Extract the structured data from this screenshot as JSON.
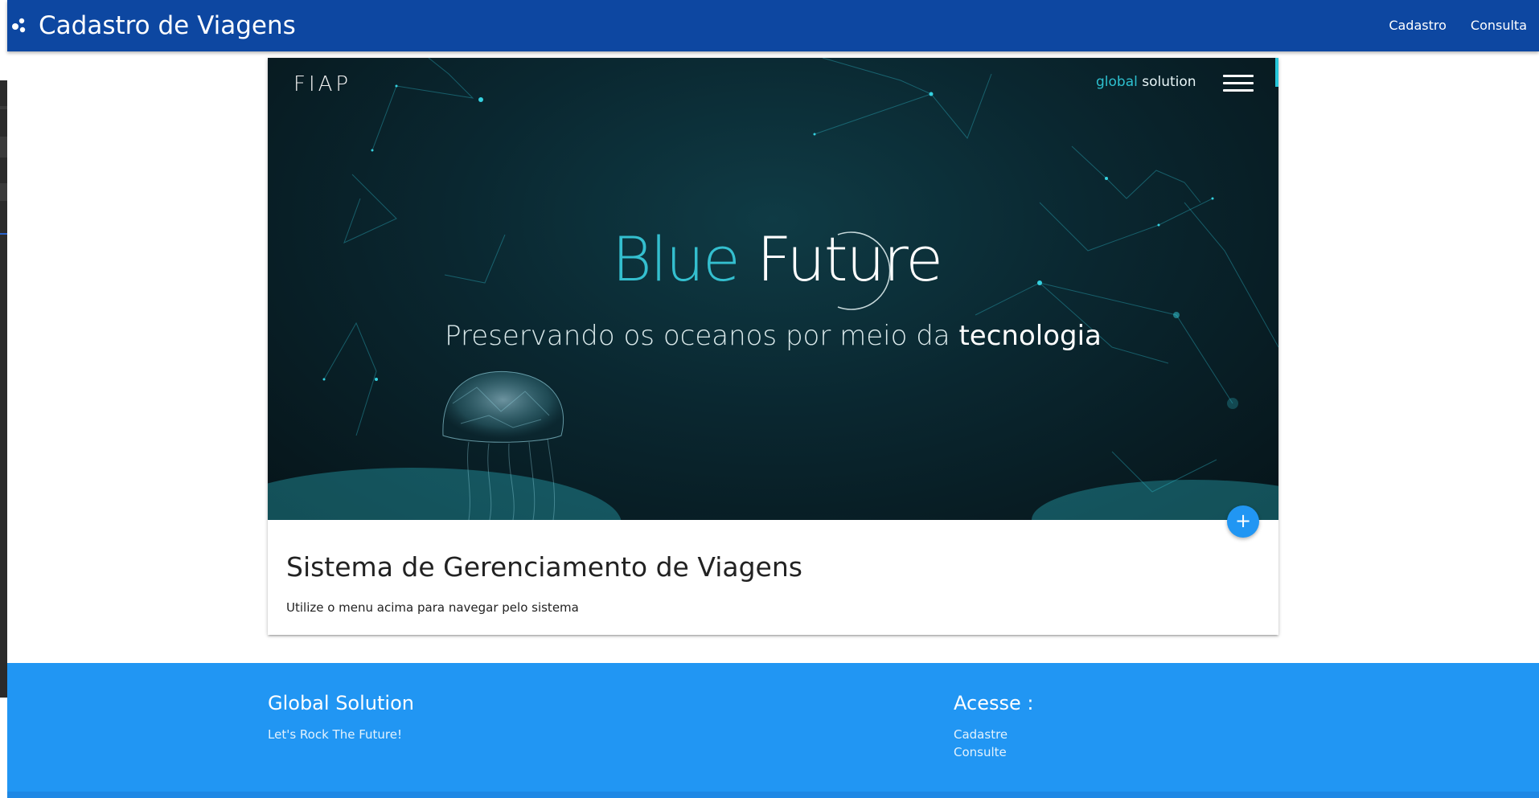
{
  "navbar": {
    "title": "Cadastro de Viagens",
    "logo_icon": "circles-logo-icon",
    "links": [
      "Cadastro",
      "Consulta"
    ],
    "color": "#0d47a1"
  },
  "hero": {
    "fiap_logo": "FIAP",
    "gs_light": "global",
    "gs_bold": "solution",
    "brand_blue": "Blue",
    "brand_white": "Future",
    "tagline_main": "Preservando os oceanos por meio da",
    "tagline_bold": "tecnologia",
    "accent": "#34bfcf"
  },
  "card": {
    "title": "Sistema de Gerenciamento de Viagens",
    "text": "Utilize o menu acima para navegar pelo sistema",
    "fab_label": "+"
  },
  "footer": {
    "left_title": "Global Solution",
    "left_text": "Let's Rock The Future!",
    "right_title": "Acesse :",
    "links": [
      "Cadastre",
      "Consulte"
    ],
    "color": "#2196f3"
  }
}
